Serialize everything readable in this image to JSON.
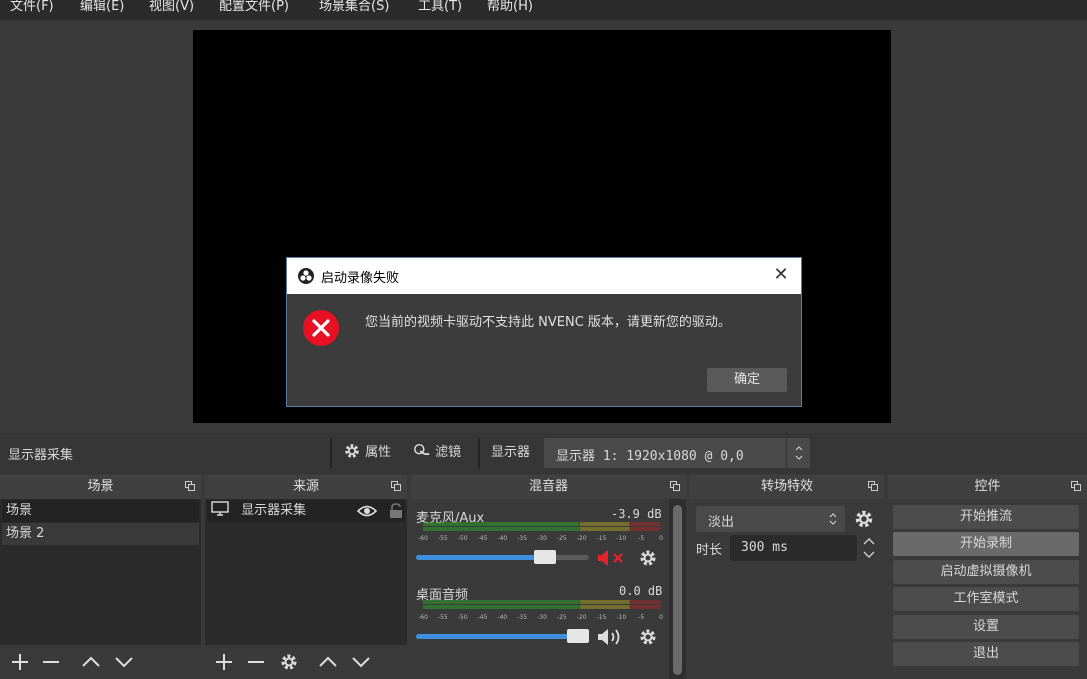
{
  "menu": [
    "文件(F)",
    "编辑(E)",
    "视图(V)",
    "配置文件(P)",
    "场景集合(S)",
    "工具(T)",
    "帮助(H)"
  ],
  "dialog": {
    "title": "启动录像失败",
    "message": "您当前的视频卡驱动不支持此 NVENC 版本，请更新您的驱动。",
    "ok": "确定"
  },
  "context": {
    "source_name": "显示器采集",
    "properties": "属性",
    "filters": "滤镜",
    "display_label": "显示器",
    "display_value": "显示器 1: 1920x1080 @ 0,0"
  },
  "scenes": {
    "title": "场景",
    "items": [
      "场景",
      "场景 2"
    ]
  },
  "sources": {
    "title": "来源",
    "items": [
      "显示器采集"
    ]
  },
  "mixer": {
    "title": "混音器",
    "channels": [
      {
        "name": "麦克风/Aux",
        "db": "-3.9 dB",
        "volume": 0.78,
        "muted": true,
        "level": 0.01
      },
      {
        "name": "桌面音频",
        "db": "0.0 dB",
        "volume": 1.0,
        "muted": false,
        "level": 0.0
      }
    ],
    "ticks_a": [
      "-60",
      "-55",
      "-50",
      "-45",
      "-40",
      "-35",
      "-30",
      "-25",
      "-20",
      "-15",
      "-10",
      "-5",
      "0"
    ],
    "ticks_b": [
      "-60",
      "-55",
      "-50",
      "-45",
      "-40",
      "-35",
      "-30",
      "-25",
      "-20",
      "-15",
      "-10",
      "-5",
      "0"
    ]
  },
  "transitions": {
    "title": "转场特效",
    "selected": "淡出",
    "duration_label": "时长",
    "duration": "300 ms"
  },
  "controls": {
    "title": "控件",
    "buttons": [
      "开始推流",
      "开始录制",
      "启动虚拟摄像机",
      "工作室模式",
      "设置",
      "退出"
    ]
  },
  "colors": {
    "accent": "#3e8ede",
    "error": "#e81123",
    "meter_green": "#2e9e2e",
    "meter_yellow": "#a59a27",
    "meter_red": "#a12a2a"
  }
}
